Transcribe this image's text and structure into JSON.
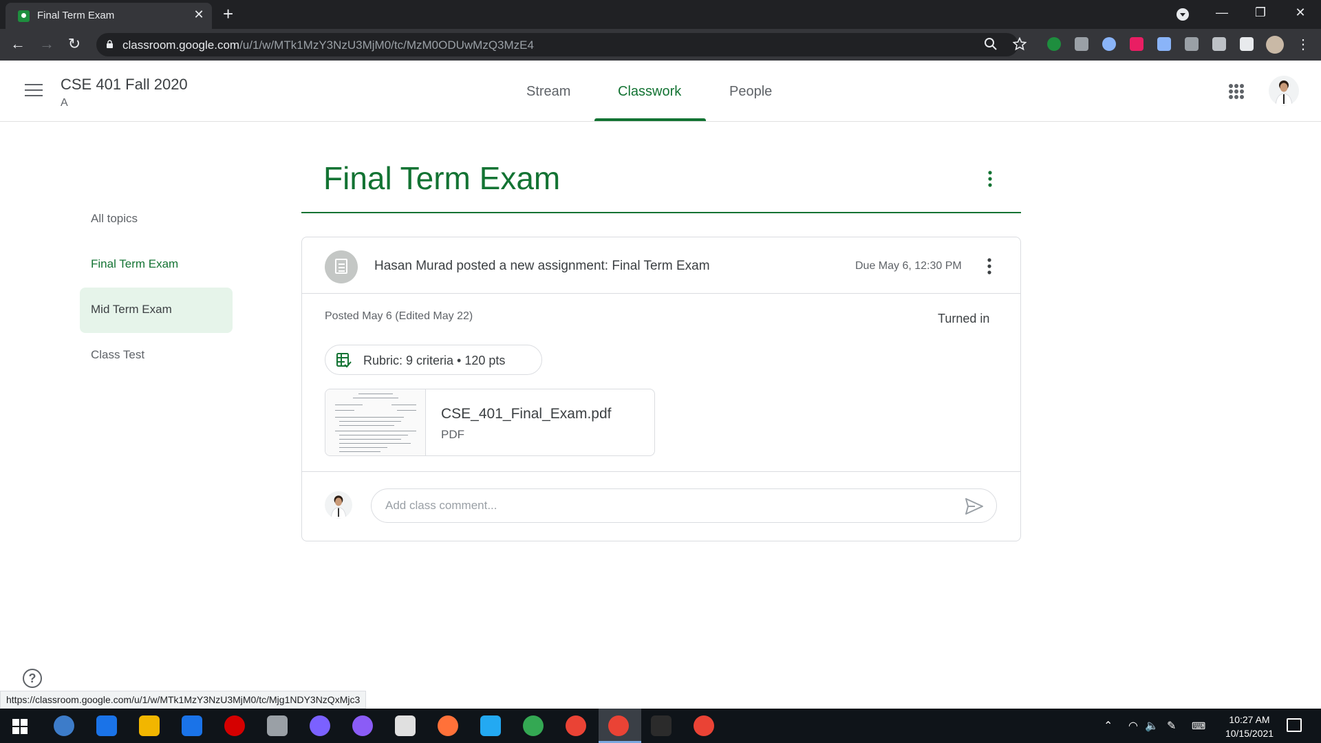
{
  "browser": {
    "tab_title": "Final Term Exam",
    "tab_close": "✕",
    "new_tab": "+",
    "url_host": "classroom.google.com",
    "url_path": "/u/1/w/MTk1MzY3NzU3MjM0/tc/MzM0ODUwMzQ3MzE4",
    "window_controls": {
      "minimize": "—",
      "restore": "❐",
      "close": "✕"
    },
    "nav": {
      "back": "←",
      "forward": "→",
      "reload": "↻"
    },
    "extension_colors": [
      "#1e8e3e",
      "#9aa0a6",
      "#8ab4f8",
      "#e91e63",
      "#8ab4f8",
      "#9aa0a6",
      "#bdc1c6",
      "#e8eaed"
    ]
  },
  "header": {
    "class_name": "CSE 401 Fall 2020",
    "class_section": "A",
    "tabs": [
      {
        "label": "Stream",
        "active": false
      },
      {
        "label": "Classwork",
        "active": true
      },
      {
        "label": "People",
        "active": false
      }
    ]
  },
  "page": {
    "title": "Final Term Exam"
  },
  "topics": {
    "items": [
      {
        "label": "All topics"
      },
      {
        "label": "Final Term Exam"
      },
      {
        "label": "Mid Term Exam"
      },
      {
        "label": "Class Test"
      }
    ]
  },
  "assignment": {
    "headline": "Hasan Murad posted a new assignment: Final Term Exam",
    "due": "Due May 6, 12:30 PM",
    "posted": "Posted May 6 (Edited May 22)",
    "status": "Turned in",
    "rubric": "Rubric: 9 criteria • 120 pts",
    "attachment": {
      "name": "CSE_401_Final_Exam.pdf",
      "type": "PDF"
    },
    "comment_placeholder": "Add class comment..."
  },
  "help": {
    "symbol": "?"
  },
  "status_bar": {
    "url": "https://classroom.google.com/u/1/w/MTk1MzY3NzU3MjM0/tc/Mjg1NDY3NzQxMjc3"
  },
  "taskbar": {
    "apps": [
      {
        "name": "qbittorrent",
        "color": "#3d7cc9"
      },
      {
        "name": "edge",
        "color": "#1a73e8"
      },
      {
        "name": "file-explorer",
        "color": "#f2b600"
      },
      {
        "name": "mail",
        "color": "#1a73e8"
      },
      {
        "name": "opera",
        "color": "#d50000"
      },
      {
        "name": "inkscape",
        "color": "#9aa0a6"
      },
      {
        "name": "messenger",
        "color": "#7b61ff"
      },
      {
        "name": "github",
        "color": "#8b5cf6"
      },
      {
        "name": "paint",
        "color": "#e0e0e0"
      },
      {
        "name": "firefox",
        "color": "#ff7139"
      },
      {
        "name": "vscode",
        "color": "#23a9f2"
      },
      {
        "name": "maps",
        "color": "#34a853"
      },
      {
        "name": "chrome",
        "color": "#ea4335"
      },
      {
        "name": "chrome-active",
        "color": "#ea4335"
      },
      {
        "name": "terminal",
        "color": "#2b2b2b"
      },
      {
        "name": "chrome-profile",
        "color": "#ea4335"
      }
    ],
    "time": "10:27 AM",
    "date": "10/15/2021"
  }
}
